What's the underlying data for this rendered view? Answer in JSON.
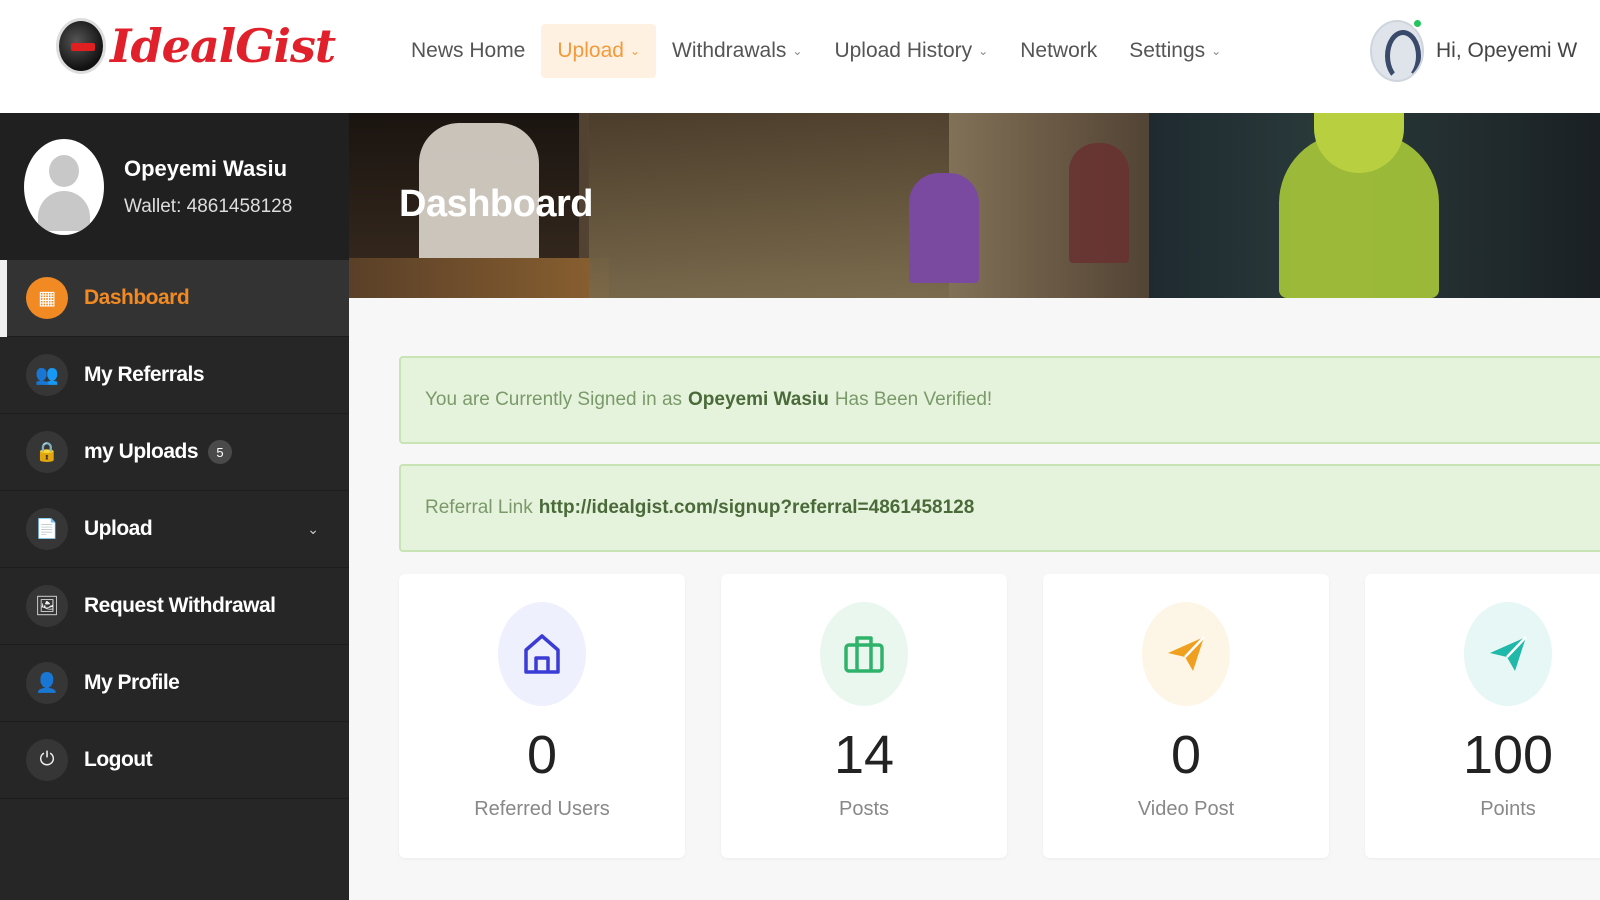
{
  "brand": {
    "logo_text": "IdealGist"
  },
  "nav": {
    "items": [
      {
        "label": "News Home",
        "has_menu": false
      },
      {
        "label": "Upload",
        "has_menu": true,
        "active": true
      },
      {
        "label": "Withdrawals",
        "has_menu": true
      },
      {
        "label": "Upload History",
        "has_menu": true
      },
      {
        "label": "Network",
        "has_menu": false
      },
      {
        "label": "Settings",
        "has_menu": true
      }
    ],
    "chevron": "⌄"
  },
  "user": {
    "greeting": "Hi, Opeyemi W",
    "name": "Opeyemi Wasiu",
    "wallet": "Wallet: 4861458128",
    "status": "online"
  },
  "sidebar": {
    "items": [
      {
        "label": "Dashboard",
        "icon": "dashboard-icon",
        "glyph": "▦",
        "active": true
      },
      {
        "label": "My Referrals",
        "icon": "users-icon",
        "glyph": "👥"
      },
      {
        "label": "my Uploads",
        "icon": "lock-icon",
        "glyph": "🔒",
        "badge": "5"
      },
      {
        "label": "Upload",
        "icon": "document-icon",
        "glyph": "📄",
        "has_menu": true
      },
      {
        "label": "Request Withdrawal",
        "icon": "image-icon",
        "glyph": "🖼"
      },
      {
        "label": "My Profile",
        "icon": "user-icon",
        "glyph": "👤"
      },
      {
        "label": "Logout",
        "icon": "power-icon",
        "glyph": "⏻"
      }
    ]
  },
  "banner": {
    "title": "Dashboard"
  },
  "alerts": {
    "signed_in_prefix": "You are Currently Signed in as",
    "signed_in_name": "Opeyemi Wasiu",
    "signed_in_suffix": "Has Been Verified!",
    "referral_prefix": "Referral Link",
    "referral_link": "http://idealgist.com/signup?referral=4861458128"
  },
  "stats": [
    {
      "value": "0",
      "label": "Referred Users",
      "icon": "home-icon",
      "color": "#3b3bd6",
      "bg": "#eef0fd"
    },
    {
      "value": "14",
      "label": "Posts",
      "icon": "briefcase-icon",
      "color": "#2fb36b",
      "bg": "#eaf7ef"
    },
    {
      "value": "0",
      "label": "Video Post",
      "icon": "send-icon",
      "color": "#f0a020",
      "bg": "#fdf6e6"
    },
    {
      "value": "100",
      "label": "Points",
      "icon": "send-icon",
      "color": "#20b8a8",
      "bg": "#e6f7f5"
    }
  ],
  "colors": {
    "accent": "#f28a24",
    "sidebar_bg": "#262626",
    "alert_bg": "#e6f3dc"
  }
}
